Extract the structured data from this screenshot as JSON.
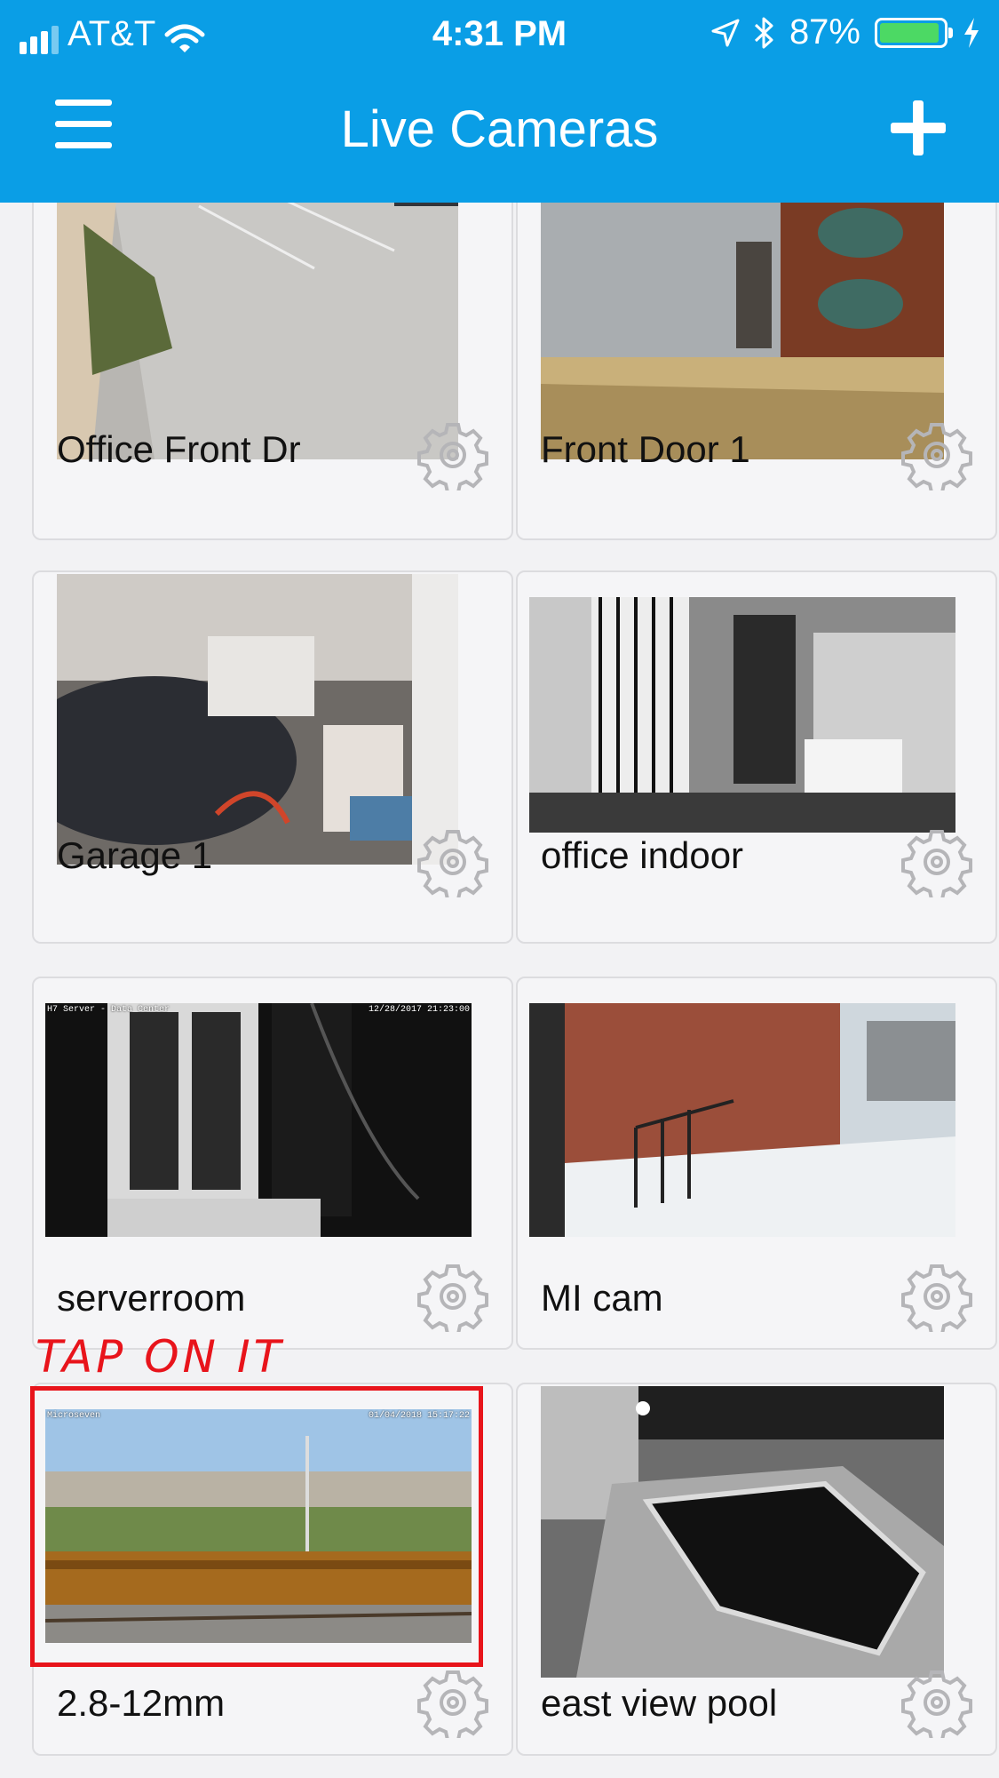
{
  "status_bar": {
    "carrier": "AT&T",
    "time": "4:31 PM",
    "battery": "87%",
    "battery_level": 0.87
  },
  "header": {
    "title": "Live Cameras",
    "menu_icon": "hamburger-menu-icon",
    "add_icon": "plus-icon"
  },
  "cameras": [
    {
      "label": "Office Front Dr"
    },
    {
      "label": "Front Door 1"
    },
    {
      "label": "Garage 1"
    },
    {
      "label": "office indoor"
    },
    {
      "label": "serverroom",
      "overlay_left": "H7 Server - Data Center",
      "overlay_right": "12/28/2017 21:23:00"
    },
    {
      "label": "MI cam"
    },
    {
      "label": "2.8-12mm",
      "overlay_left": "Microseven",
      "overlay_right": "01/04/2018 15:17:22"
    },
    {
      "label": "east view pool"
    }
  ],
  "annotation": {
    "text": "TAP ON IT",
    "color": "#e8141b"
  },
  "colors": {
    "accent": "#0a9ee6",
    "battery": "#4cd964"
  }
}
